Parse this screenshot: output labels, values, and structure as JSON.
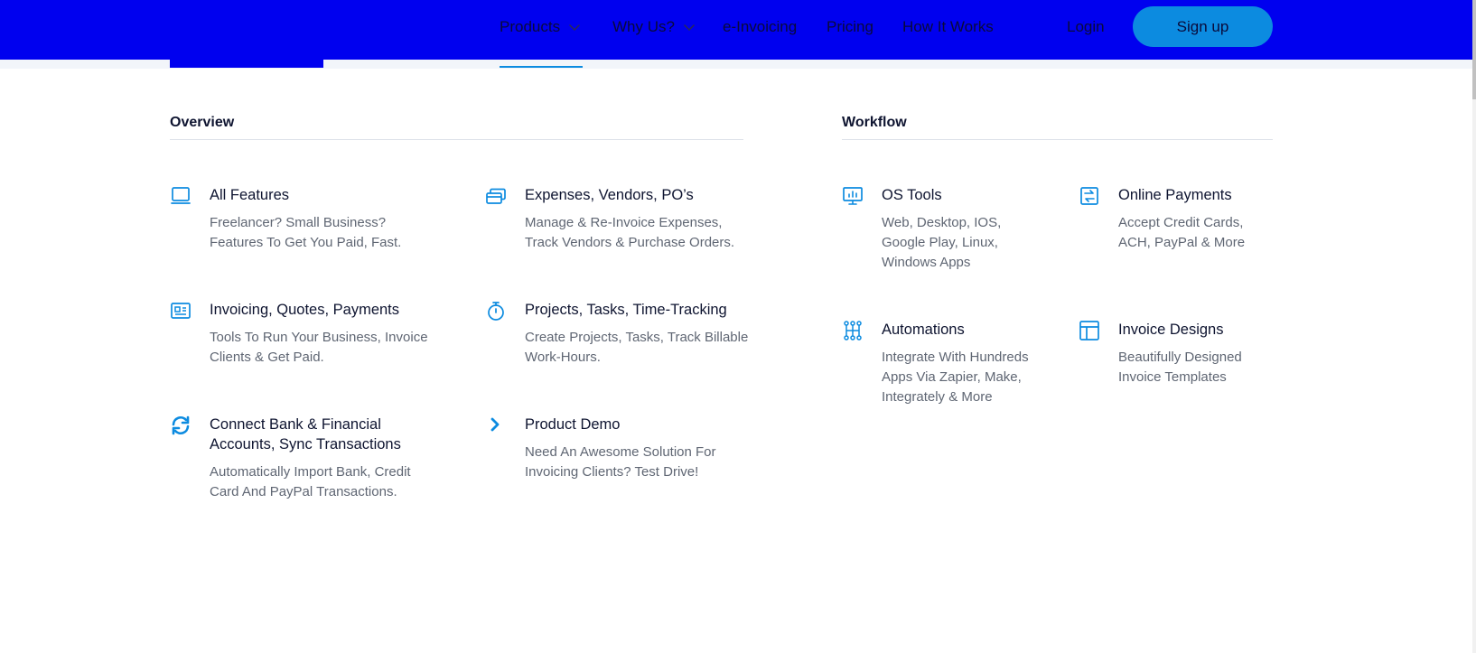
{
  "nav": {
    "items": [
      {
        "label": "Products",
        "has_chevron": true
      },
      {
        "label": "Why Us?",
        "has_chevron": true
      },
      {
        "label": "e-Invoicing",
        "has_chevron": false
      },
      {
        "label": "Pricing",
        "has_chevron": false
      },
      {
        "label": "How It Works",
        "has_chevron": false
      }
    ],
    "login_label": "Login",
    "signup_label": "Sign up"
  },
  "menu": {
    "overview": {
      "title": "Overview",
      "items": [
        {
          "icon": "laptop-icon",
          "title": "All Features",
          "desc": "Freelancer? Small Business? Features To Get You Paid, Fast."
        },
        {
          "icon": "card-stack-icon",
          "title": "Expenses, Vendors, PO’s",
          "desc": "Manage & Re-Invoice Expenses, Track Vendors & Purchase Orders."
        },
        {
          "icon": "invoice-card-icon",
          "title": "Invoicing, Quotes, Payments",
          "desc": "Tools To Run Your Business, Invoice Clients & Get Paid."
        },
        {
          "icon": "stopwatch-icon",
          "title": "Projects, Tasks, Time-Tracking",
          "desc": "Create Projects, Tasks, Track Billable Work-Hours."
        },
        {
          "icon": "sync-icon",
          "title": "Connect Bank & Financial Accounts, Sync Transactions",
          "desc": "Automatically Import Bank, Credit Card And PayPal Transactions."
        },
        {
          "icon": "chevron-right-icon",
          "title": "Product Demo",
          "desc": "Need An Awesome Solution For Invoicing Clients? Test Drive!"
        }
      ]
    },
    "workflow": {
      "title": "Workflow",
      "items": [
        {
          "icon": "monitor-chart-icon",
          "title": "OS Tools",
          "desc": "Web, Desktop, IOS, Google Play, Linux, Windows Apps"
        },
        {
          "icon": "transfer-icon",
          "title": "Online Payments",
          "desc": "Accept Credit Cards, ACH, PayPal & More"
        },
        {
          "icon": "automation-icon",
          "title": "Automations",
          "desc": "Integrate With Hundreds Apps Via Zapier, Make, Integrately & More"
        },
        {
          "icon": "layout-icon",
          "title": "Invoice Designs",
          "desc": "Beautifully Designed Invoice Templates"
        }
      ]
    }
  },
  "colors": {
    "topbar": "#0000ef",
    "accent": "#0c8be0",
    "text_dark": "#0e1430",
    "text_muted": "#5f6673"
  }
}
